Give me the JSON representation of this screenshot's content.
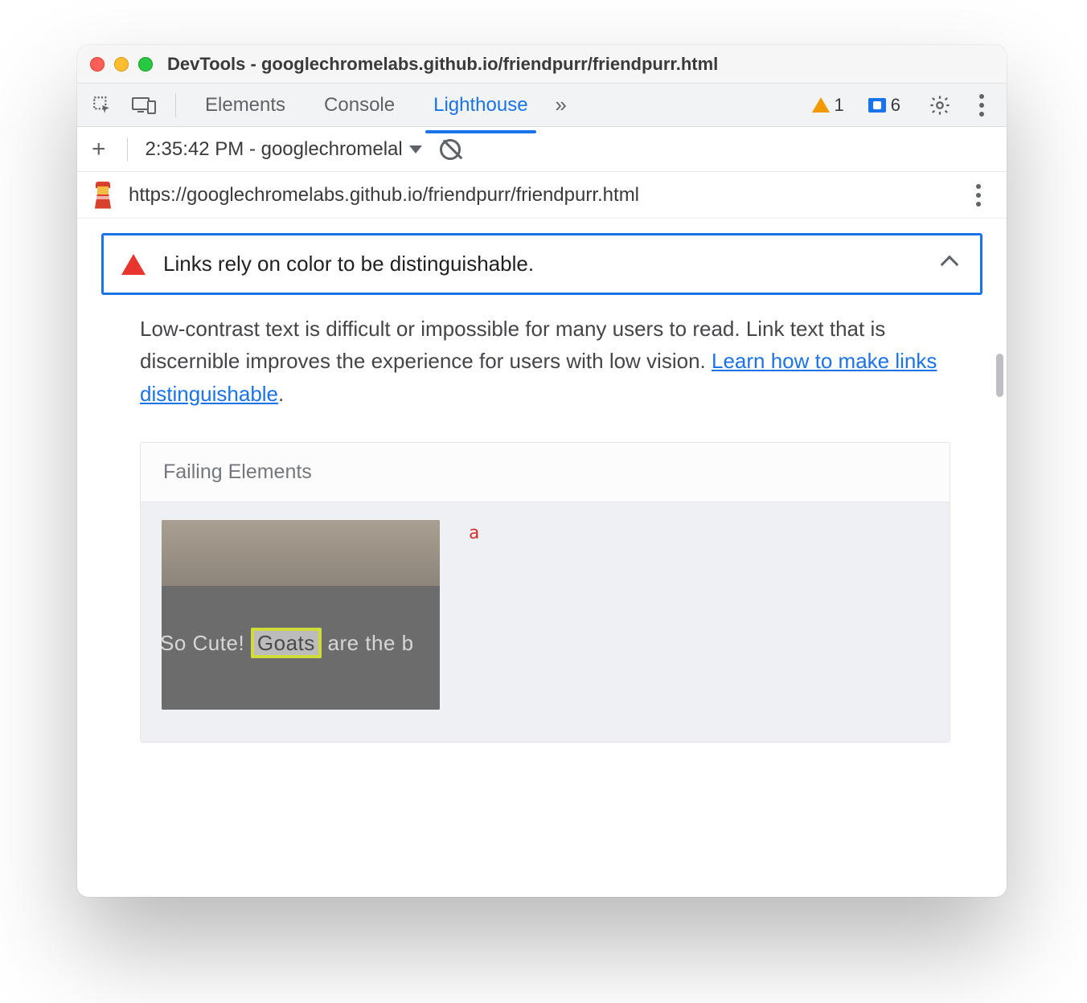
{
  "window": {
    "title": "DevTools - googlechromelabs.github.io/friendpurr/friendpurr.html"
  },
  "tabs": {
    "elements": "Elements",
    "console": "Console",
    "lighthouse": "Lighthouse"
  },
  "counters": {
    "warnings": "1",
    "messages": "6"
  },
  "reportbar": {
    "label": "2:35:42 PM - googlechromelal"
  },
  "url": "https://googlechromelabs.github.io/friendpurr/friendpurr.html",
  "audit": {
    "title": "Links rely on color to be distinguishable.",
    "description_a": "Low-contrast text is difficult or impossible for many users to read. Link text that is discernible improves the experience for users with low vision. ",
    "link_text": "Learn how to make links distinguishable",
    "description_b": "."
  },
  "failing": {
    "header": "Failing Elements",
    "tag": "a",
    "thumb_text_before": "So Cute! ",
    "thumb_text_hl": "Goats",
    "thumb_text_after": " are the b"
  }
}
